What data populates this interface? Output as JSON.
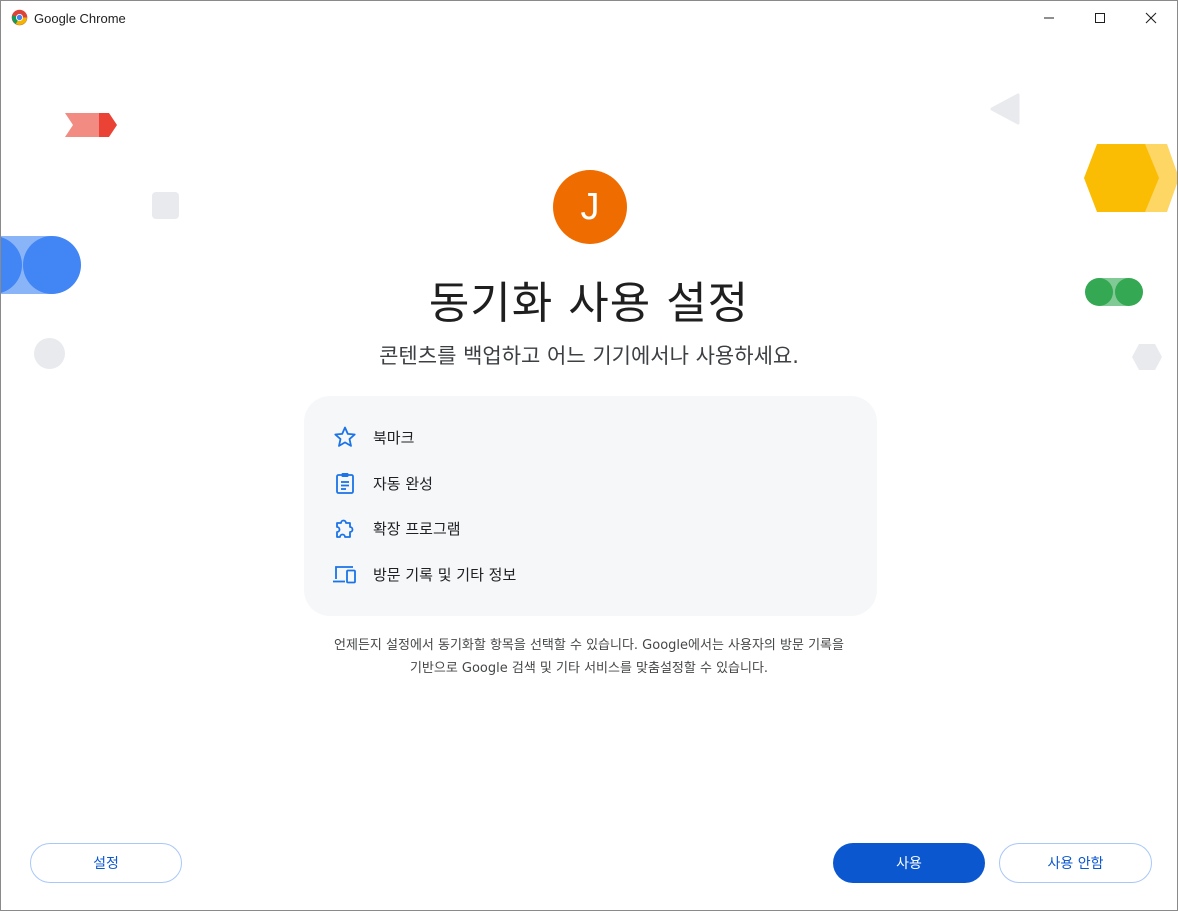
{
  "window": {
    "title": "Google Chrome",
    "controls": {
      "minimize_icon": "minimize-icon",
      "maximize_icon": "maximize-icon",
      "close_icon": "close-icon"
    }
  },
  "profile": {
    "avatar_initial": "J",
    "avatar_color": "#ef6c00"
  },
  "heading": "동기화 사용 설정",
  "subheading": "콘텐츠를 백업하고 어느 기기에서나 사용하세요.",
  "sync_items": [
    {
      "icon": "star-icon",
      "label": "북마크"
    },
    {
      "icon": "clipboard-icon",
      "label": "자동 완성"
    },
    {
      "icon": "puzzle-icon",
      "label": "확장 프로그램"
    },
    {
      "icon": "devices-icon",
      "label": "방문 기록 및 기타 정보"
    }
  ],
  "note": {
    "line1": "언제든지 설정에서 동기화할 항목을 선택할 수 있습니다. Google에서는 사용자의 방문 기록을",
    "line2": "기반으로 Google 검색 및 기타 서비스를 맞춤설정할 수 있습니다."
  },
  "buttons": {
    "settings": "설정",
    "accept": "사용",
    "decline": "사용 안함"
  },
  "colors": {
    "accent": "#0b57d0",
    "icon_blue": "#1a73e8",
    "card_bg": "#f6f7f9"
  }
}
